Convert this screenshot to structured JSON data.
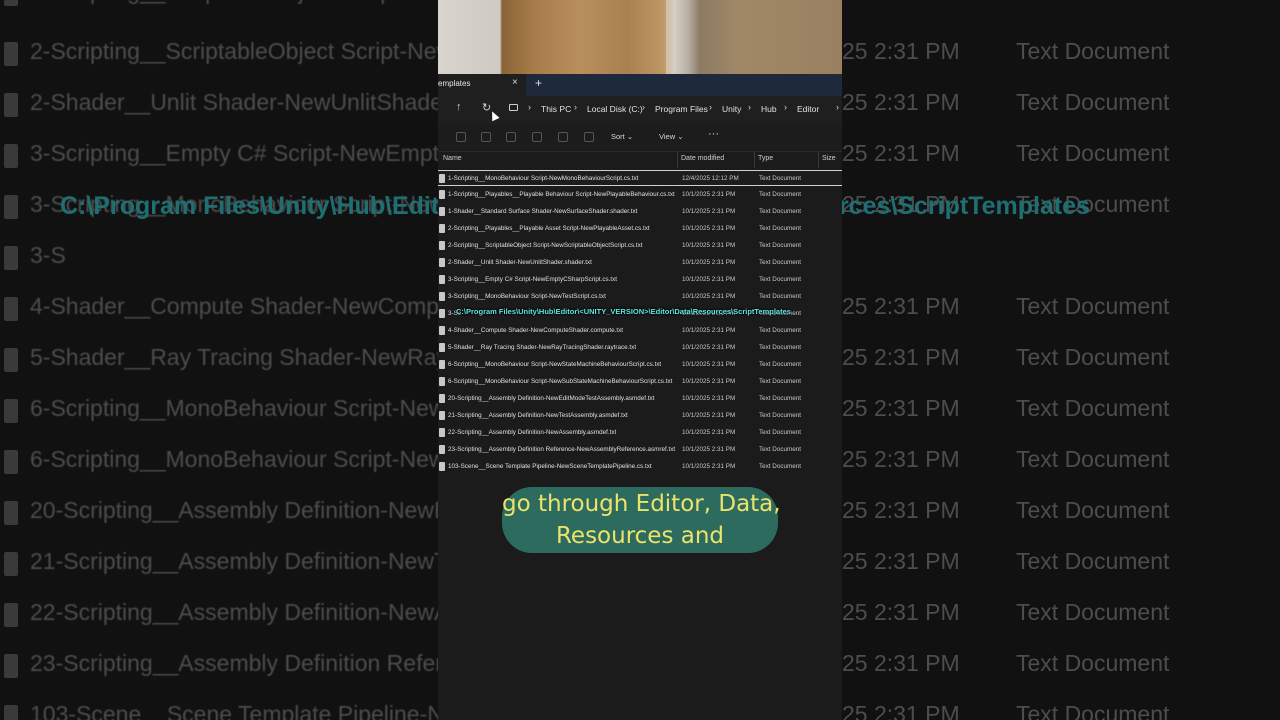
{
  "tab": {
    "label": "emplates",
    "close": "×",
    "add": "+"
  },
  "nav": {
    "up": "↑",
    "refresh": "↻"
  },
  "breadcrumb": [
    "This PC",
    "Local Disk (C:)",
    "Program Files",
    "Unity",
    "Hub",
    "Editor"
  ],
  "breadcrumb_sep": "›",
  "toolbar": {
    "sort_label": "Sort ⌄",
    "view_label": "View ⌄",
    "more_label": "···"
  },
  "columns": {
    "name": "Name",
    "date": "Date modified",
    "type": "Type",
    "size": "Size"
  },
  "files": [
    {
      "name": "1-Scripting__MonoBehaviour Script-NewMonoBehaviourScript.cs.txt",
      "date": "12/4/2025 12:12 PM",
      "type": "Text Document"
    },
    {
      "name": "1-Scripting__Playables__Playable Behaviour Script-NewPlayableBehaviour.cs.txt",
      "date": "10/1/2025 2:31 PM",
      "type": "Text Document"
    },
    {
      "name": "1-Shader__Standard Surface Shader-NewSurfaceShader.shader.txt",
      "date": "10/1/2025 2:31 PM",
      "type": "Text Document"
    },
    {
      "name": "2-Scripting__Playables__Playable Asset Script-NewPlayableAsset.cs.txt",
      "date": "10/1/2025 2:31 PM",
      "type": "Text Document"
    },
    {
      "name": "2-Scripting__ScriptableObject Script-NewScriptableObjectScript.cs.txt",
      "date": "10/1/2025 2:31 PM",
      "type": "Text Document"
    },
    {
      "name": "2-Shader__Unlit Shader-NewUnlitShader.shader.txt",
      "date": "10/1/2025 2:31 PM",
      "type": "Text Document"
    },
    {
      "name": "3-Scripting__Empty C# Script-NewEmptyCSharpScript.cs.txt",
      "date": "10/1/2025 2:31 PM",
      "type": "Text Document"
    },
    {
      "name": "3-Scripting__MonoBehaviour Script-NewTestScript.cs.txt",
      "date": "10/1/2025 2:31 PM",
      "type": "Text Document"
    },
    {
      "name": "3-Sc",
      "date": "10/1/2025 2:31 PM",
      "type": "Text Document"
    },
    {
      "name": "4-Shader__Compute Shader-NewComputeShader.compute.txt",
      "date": "10/1/2025 2:31 PM",
      "type": "Text Document"
    },
    {
      "name": "5-Shader__Ray Tracing Shader-NewRayTracingShader.raytrace.txt",
      "date": "10/1/2025 2:31 PM",
      "type": "Text Document"
    },
    {
      "name": "6-Scripting__MonoBehaviour Script-NewStateMachineBehaviourScript.cs.txt",
      "date": "10/1/2025 2:31 PM",
      "type": "Text Document"
    },
    {
      "name": "6-Scripting__MonoBehaviour Script-NewSubStateMachineBehaviourScript.cs.txt",
      "date": "10/1/2025 2:31 PM",
      "type": "Text Document"
    },
    {
      "name": "20-Scripting__Assembly Definition-NewEditModeTestAssembly.asmdef.txt",
      "date": "10/1/2025 2:31 PM",
      "type": "Text Document"
    },
    {
      "name": "21-Scripting__Assembly Definition-NewTestAssembly.asmdef.txt",
      "date": "10/1/2025 2:31 PM",
      "type": "Text Document"
    },
    {
      "name": "22-Scripting__Assembly Definition-NewAssembly.asmdef.txt",
      "date": "10/1/2025 2:31 PM",
      "type": "Text Document"
    },
    {
      "name": "23-Scripting__Assembly Definition Reference-NewAssemblyReference.asmref.txt",
      "date": "10/1/2025 2:31 PM",
      "type": "Text Document"
    },
    {
      "name": "103-Scene__Scene Template Pipeline-NewSceneTemplatePipeline.cs.txt",
      "date": "10/1/2025 2:31 PM",
      "type": "Text Document"
    }
  ],
  "overlay_path": "C:\\Program Files\\Unity\\Hub\\Editor\\<UNITY_VERSION>\\Editor\\Data\\Resources\\ScriptTemplates",
  "caption": {
    "line1": "go through Editor, Data,",
    "line2": "Resources and"
  },
  "background": {
    "path_head": "C:\\Program Files\\Unity\\Hub\\Editor",
    "path_tail": "rces\\ScriptTemplates",
    "rows": [
      {
        "name": "2-Scripting__ScriptableObject Script-NewScri",
        "date": "25 2:31 PM",
        "type": "Text Document"
      },
      {
        "name": "2-Shader__Unlit Shader-NewUnlitShader.shad",
        "date": "25 2:31 PM",
        "type": "Text Document"
      },
      {
        "name": "3-Scripting__Empty C# Script-NewEmptyCSha",
        "date": "25 2:31 PM",
        "type": "Text Document"
      },
      {
        "name": "3-Scripting__MonoBehaviour Script-NewTestS",
        "date": "25 2:31 PM",
        "type": "Text Document"
      },
      {
        "name": "3-S",
        "date": "",
        "type": ""
      },
      {
        "name": "4-Shader__Compute Shader-NewComputeSh",
        "date": "25 2:31 PM",
        "type": "Text Document"
      },
      {
        "name": "5-Shader__Ray Tracing Shader-NewRayTracing",
        "date": "25 2:31 PM",
        "type": "Text Document"
      },
      {
        "name": "6-Scripting__MonoBehaviour Script-NewState",
        "date": "25 2:31 PM",
        "type": "Text Document"
      },
      {
        "name": "6-Scripting__MonoBehaviour Script-NewSubS",
        "date": "25 2:31 PM",
        "type": "Text Document"
      },
      {
        "name": "20-Scripting__Assembly Definition-NewEditM",
        "date": "25 2:31 PM",
        "type": "Text Document"
      },
      {
        "name": "21-Scripting__Assembly Definition-NewTestAs",
        "date": "25 2:31 PM",
        "type": "Text Document"
      },
      {
        "name": "22-Scripting__Assembly Definition-NewAssem",
        "date": "25 2:31 PM",
        "type": "Text Document"
      },
      {
        "name": "23-Scripting__Assembly Definition Reference-",
        "date": "25 2:31 PM",
        "type": "Text Document"
      },
      {
        "name": "103-Scene__Scene Template Pipeline-NewSc",
        "date": "25 2:31 PM",
        "type": "Text Document"
      }
    ]
  }
}
